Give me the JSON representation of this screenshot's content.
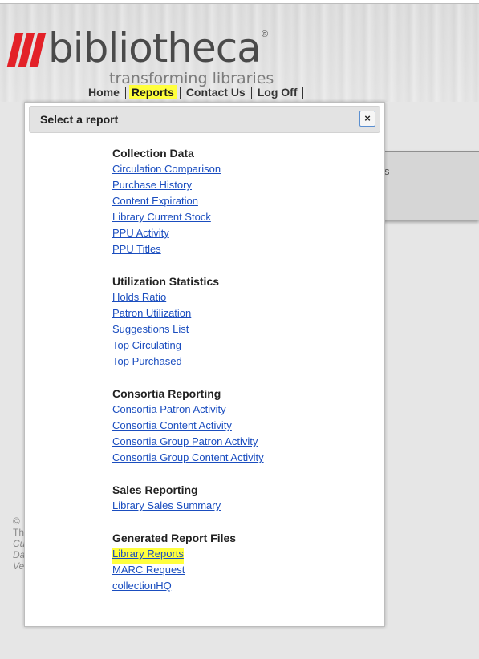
{
  "header": {
    "logo_text": "bibliotheca",
    "logo_reg": "®",
    "tagline": "transforming libraries",
    "nav": [
      {
        "label": "Home"
      },
      {
        "label": "Reports"
      },
      {
        "label": "Contact Us"
      },
      {
        "label": "Log Off"
      }
    ]
  },
  "background": {
    "panel_text": "s",
    "footer_lines": [
      "©",
      "Th",
      "Cu",
      "Da",
      "Ve"
    ]
  },
  "modal": {
    "title": "Select a report",
    "close_label": "×",
    "sections": [
      {
        "heading": "Collection Data",
        "items": [
          "Circulation Comparison",
          "Purchase History",
          "Content Expiration",
          "Library Current Stock",
          "PPU Activity",
          "PPU Titles"
        ]
      },
      {
        "heading": "Utilization Statistics",
        "items": [
          "Holds Ratio",
          "Patron Utilization",
          "Suggestions List",
          "Top Circulating",
          "Top Purchased"
        ]
      },
      {
        "heading": "Consortia Reporting",
        "items": [
          "Consortia Patron Activity",
          "Consortia Content Activity",
          "Consortia Group Patron Activity",
          "Consortia Group Content Activity"
        ]
      },
      {
        "heading": "Sales Reporting",
        "items": [
          "Library Sales Summary"
        ]
      },
      {
        "heading": "Generated Report Files",
        "items": [
          "Library Reports",
          "MARC Request",
          "collectionHQ"
        ]
      }
    ]
  },
  "colors": {
    "brand_red": "#e32128",
    "highlight": "#ffff3c",
    "link": "#1a4dbf"
  }
}
